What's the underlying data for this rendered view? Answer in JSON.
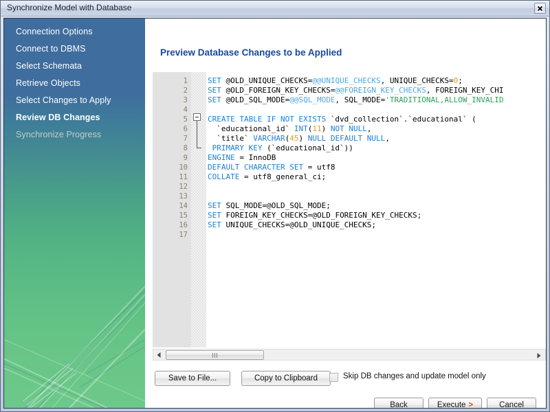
{
  "window": {
    "title": "Synchronize Model with Database",
    "close_icon": "close-icon"
  },
  "sidebar": {
    "items": [
      {
        "label": "Connection Options",
        "state": "done"
      },
      {
        "label": "Connect to DBMS",
        "state": "done"
      },
      {
        "label": "Select Schemata",
        "state": "done"
      },
      {
        "label": "Retrieve Objects",
        "state": "done"
      },
      {
        "label": "Select Changes to Apply",
        "state": "done"
      },
      {
        "label": "Review DB Changes",
        "state": "active"
      },
      {
        "label": "Synchronize Progress",
        "state": "disabled"
      }
    ]
  },
  "content": {
    "heading": "Preview Database Changes to be Applied"
  },
  "editor": {
    "line_numbers": [
      "1",
      "2",
      "3",
      "4",
      "5",
      "6",
      "7",
      "8",
      "9",
      "10",
      "11",
      "12",
      "13",
      "14",
      "15",
      "16",
      "17"
    ],
    "fold_marker": "collapse-icon",
    "lines": [
      [
        {
          "t": "SET ",
          "c": "kw"
        },
        {
          "t": "@OLD_UNIQUE_CHECKS=",
          "c": ""
        },
        {
          "t": "@@UNIQUE_CHECKS",
          "c": "var"
        },
        {
          "t": ", UNIQUE_CHECKS=",
          "c": ""
        },
        {
          "t": "0",
          "c": "num"
        },
        {
          "t": ";",
          "c": ""
        }
      ],
      [
        {
          "t": "SET ",
          "c": "kw"
        },
        {
          "t": "@OLD_FOREIGN_KEY_CHECKS=",
          "c": ""
        },
        {
          "t": "@@FOREIGN_KEY_CHECKS",
          "c": "var"
        },
        {
          "t": ", FOREIGN_KEY_CHI",
          "c": ""
        }
      ],
      [
        {
          "t": "SET ",
          "c": "kw"
        },
        {
          "t": "@OLD_SQL_MODE=",
          "c": ""
        },
        {
          "t": "@@SQL_MODE",
          "c": "var"
        },
        {
          "t": ", SQL_MODE=",
          "c": ""
        },
        {
          "t": "'TRADITIONAL,ALLOW_INVALID",
          "c": "str"
        }
      ],
      [],
      [
        {
          "t": "CREATE TABLE IF NOT EXISTS ",
          "c": "kw"
        },
        {
          "t": "`dvd_collection`.`educational` (",
          "c": ""
        }
      ],
      [
        {
          "t": "  `educational_id` ",
          "c": ""
        },
        {
          "t": "INT",
          "c": "kw"
        },
        {
          "t": "(",
          "c": ""
        },
        {
          "t": "11",
          "c": "num"
        },
        {
          "t": ") ",
          "c": ""
        },
        {
          "t": "NOT NULL",
          "c": "kw"
        },
        {
          "t": ",",
          "c": ""
        }
      ],
      [
        {
          "t": "  `title` ",
          "c": ""
        },
        {
          "t": "VARCHAR",
          "c": "kw"
        },
        {
          "t": "(",
          "c": ""
        },
        {
          "t": "45",
          "c": "num"
        },
        {
          "t": ") ",
          "c": ""
        },
        {
          "t": "NULL DEFAULT NULL",
          "c": "kw"
        },
        {
          "t": ",",
          "c": ""
        }
      ],
      [
        {
          "t": " PRIMARY KEY ",
          "c": "kw"
        },
        {
          "t": "(`educational_id`))",
          "c": ""
        }
      ],
      [
        {
          "t": "ENGINE",
          "c": "kw"
        },
        {
          "t": " = InnoDB",
          "c": ""
        }
      ],
      [
        {
          "t": "DEFAULT CHARACTER SET",
          "c": "kw"
        },
        {
          "t": " = utf8",
          "c": ""
        }
      ],
      [
        {
          "t": "COLLATE",
          "c": "kw"
        },
        {
          "t": " = utf8_general_ci;",
          "c": ""
        }
      ],
      [],
      [],
      [
        {
          "t": "SET ",
          "c": "kw"
        },
        {
          "t": "SQL_MODE=@OLD_SQL_MODE;",
          "c": ""
        }
      ],
      [
        {
          "t": "SET ",
          "c": "kw"
        },
        {
          "t": "FOREIGN_KEY_CHECKS=@OLD_FOREIGN_KEY_CHECKS;",
          "c": ""
        }
      ],
      [
        {
          "t": "SET ",
          "c": "kw"
        },
        {
          "t": "UNIQUE_CHECKS=@OLD_UNIQUE_CHECKS;",
          "c": ""
        }
      ],
      []
    ]
  },
  "scrollbar": {
    "left_arrow_icon": "arrow-left-icon",
    "right_arrow_icon": "arrow-right-icon",
    "grip_icon": "grip-icon"
  },
  "toolbar": {
    "save_label": "Save to File...",
    "copy_label": "Copy to Clipboard",
    "skip_checkbox_label": "Skip DB changes and update model only",
    "skip_checkbox_checked": false
  },
  "footer": {
    "back_label": "Back",
    "execute_label": "Execute",
    "execute_arrow": ">",
    "cancel_label": "Cancel"
  },
  "colors": {
    "heading": "#17499c",
    "sidebar_top": "#3f6d9e",
    "sidebar_bottom": "#6dc98a",
    "keyword": "#1e7fd1",
    "variable": "#4aa8e0",
    "string": "#2ea05a",
    "number": "#e0a020",
    "execute_arrow": "#d4581b"
  }
}
